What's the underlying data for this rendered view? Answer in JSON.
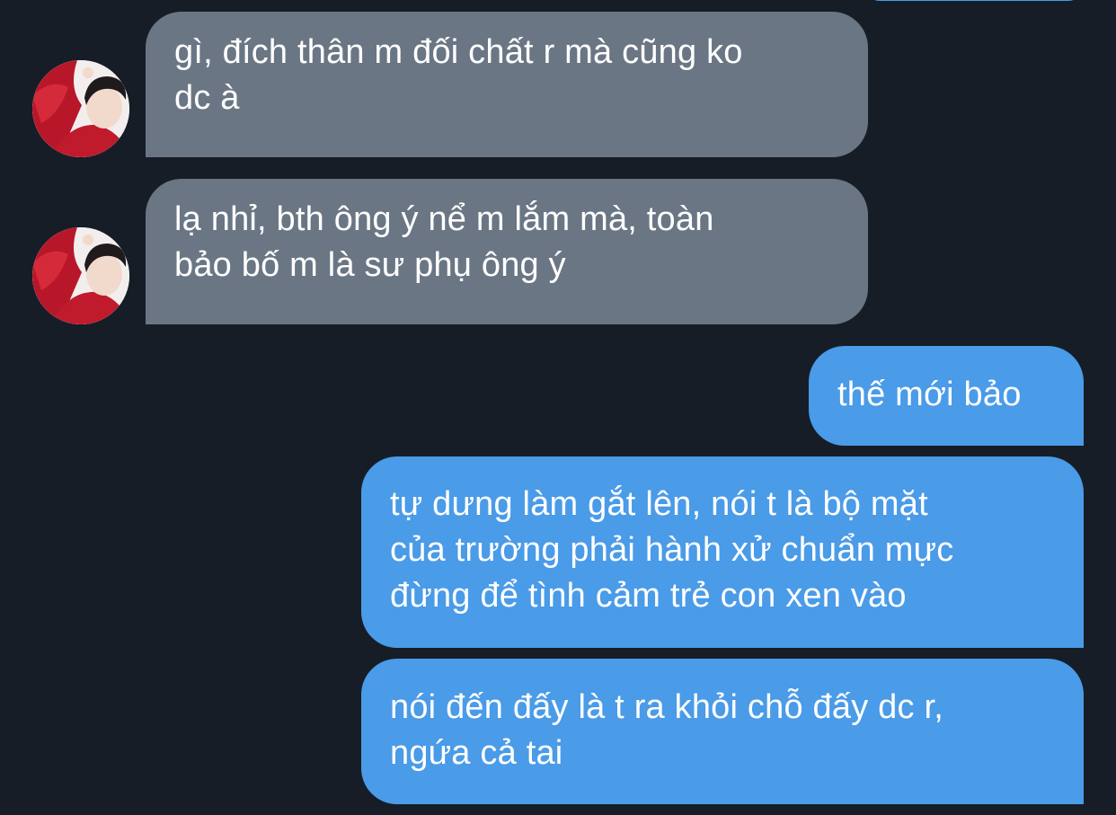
{
  "conversation": {
    "messages": [
      {
        "sender": "contact",
        "text": "gì, đích thân m đối chất r mà cũng ko\ndc à"
      },
      {
        "sender": "contact",
        "text": "lạ nhỉ, bth ông ý nể m lắm mà, toàn\nbảo bố m là sư phụ ông ý"
      },
      {
        "sender": "self",
        "text": "thế mới bảo"
      },
      {
        "sender": "self",
        "text": "tự dưng làm gắt lên, nói t là bộ mặt\ncủa trường phải hành xử chuẩn mực\nđừng để tình cảm trẻ con xen vào"
      },
      {
        "sender": "self",
        "text": "nói đến đấy là t ra khỏi chỗ đấy dc r,\nngứa cả tai"
      }
    ]
  },
  "colors": {
    "background": "#161d27",
    "incoming_bubble": "#6b7684",
    "outgoing_bubble": "#4a9be8",
    "text": "#ffffff"
  }
}
